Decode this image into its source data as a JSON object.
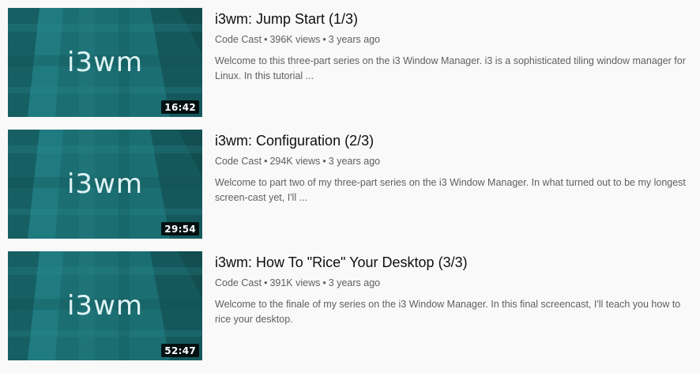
{
  "videos": [
    {
      "thumbnail_text": "i3wm",
      "duration": "16:42",
      "title": "i3wm: Jump Start (1/3)",
      "channel": "Code Cast",
      "separator": "•",
      "views": "396K views",
      "age": "3 years ago",
      "description": "Welcome to this three-part series on the i3 Window Manager. i3 is a sophisticated tiling window manager for Linux. In this tutorial ..."
    },
    {
      "thumbnail_text": "i3wm",
      "duration": "29:54",
      "title": "i3wm: Configuration (2/3)",
      "channel": "Code Cast",
      "separator": "•",
      "views": "294K views",
      "age": "3 years ago",
      "description": "Welcome to part two of my three-part series on the i3 Window Manager. In what turned out to be my longest screen-cast yet, I'll ..."
    },
    {
      "thumbnail_text": "i3wm",
      "duration": "52:47",
      "title": "i3wm: How To \"Rice\" Your Desktop (3/3)",
      "channel": "Code Cast",
      "separator": "•",
      "views": "391K views",
      "age": "3 years ago",
      "description": "Welcome to the finale of my series on the i3 Window Manager. In this final screencast, I'll teach you how to rice your desktop."
    }
  ],
  "colors": {
    "thumbnail_base": "#1b6f73",
    "thumbnail_dark": "#14575a",
    "thumbnail_light": "#2a8a8e",
    "title": "#0f0f0f",
    "meta": "#606060",
    "background": "#f9f9f9"
  }
}
